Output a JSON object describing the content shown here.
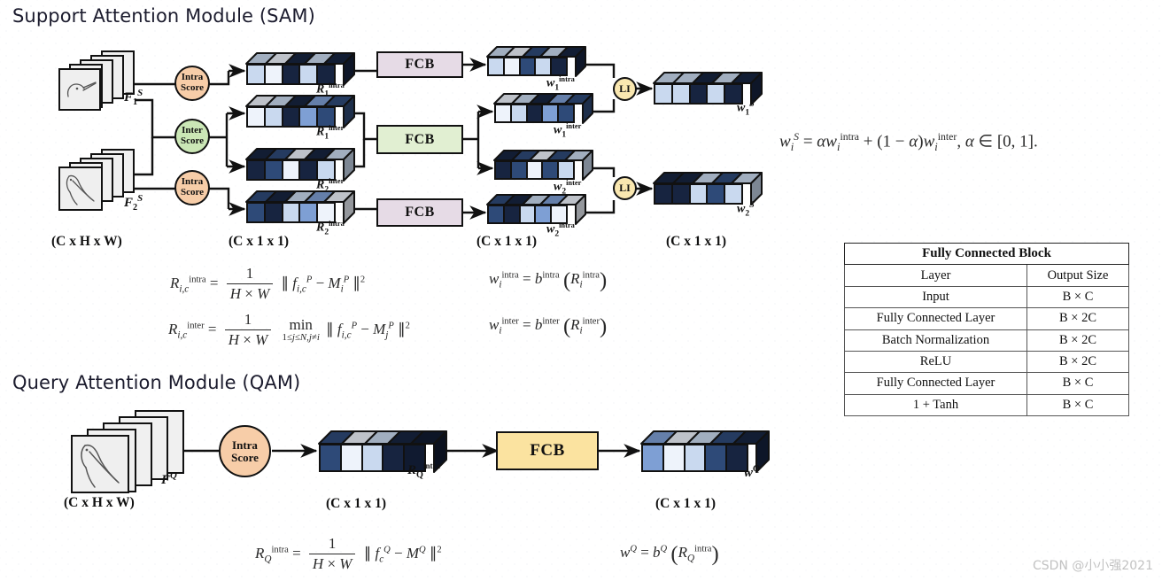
{
  "page": {
    "watermark": "CSDN @小小强2021"
  },
  "modules": {
    "sam": {
      "title": "Support Attention Module (SAM)",
      "inputs": [
        {
          "label_base": "F",
          "label_sub": "1",
          "label_sup": "S",
          "dim": "(C x H x W)",
          "icon": "bird-feature-map-stack"
        },
        {
          "label_base": "F",
          "label_sub": "2",
          "label_sup": "S",
          "icon": "bird-feature-map-stack"
        }
      ],
      "score_nodes": [
        {
          "line1": "Intra",
          "line2": "Score",
          "color": "#f7cda8"
        },
        {
          "line1": "Inter",
          "line2": "Score",
          "color": "#cbe7b6"
        },
        {
          "line1": "Intra",
          "line2": "Score",
          "color": "#f7cda8"
        }
      ],
      "r_bars": [
        {
          "name": "R",
          "sub": "1",
          "sup": "intra",
          "shades": [
            2,
            1,
            5,
            2,
            5
          ]
        },
        {
          "name": "R",
          "sub": "1",
          "sup": "inter",
          "shades": [
            1,
            2,
            5,
            3,
            4
          ]
        },
        {
          "name": "R",
          "sub": "2",
          "sup": "inter",
          "shades": [
            5,
            4,
            1,
            5,
            2
          ]
        },
        {
          "name": "R",
          "sub": "2",
          "sup": "intra",
          "shades": [
            4,
            5,
            2,
            3,
            1
          ]
        }
      ],
      "r_dim": "(C x 1 x 1)",
      "fcb_blocks": [
        {
          "label": "FCB",
          "color": "#e6dbe6"
        },
        {
          "label": "FCB",
          "color": "#e1efd2"
        },
        {
          "label": "FCB",
          "color": "#e6dbe6"
        }
      ],
      "w_bars": [
        {
          "name": "w",
          "sub": "1",
          "sup": "intra",
          "shades": [
            2,
            1,
            4,
            2,
            5
          ]
        },
        {
          "name": "w",
          "sub": "1",
          "sup": "inter",
          "shades": [
            1,
            2,
            5,
            3,
            4
          ]
        },
        {
          "name": "w",
          "sub": "2",
          "sup": "inter",
          "shades": [
            5,
            4,
            1,
            4,
            2
          ]
        },
        {
          "name": "w",
          "sub": "2",
          "sup": "intra",
          "shades": [
            4,
            5,
            2,
            3,
            1
          ]
        }
      ],
      "w_dim": "(C x 1 x 1)",
      "li_nodes": [
        {
          "label": "LI",
          "color": "#f9e7b0"
        },
        {
          "label": "LI",
          "color": "#f9e7b0"
        }
      ],
      "out_bars": [
        {
          "name": "w",
          "sub": "1",
          "sup": "S",
          "shades": [
            2,
            2,
            5,
            2,
            5
          ]
        },
        {
          "name": "w",
          "sub": "2",
          "sup": "S",
          "shades": [
            5,
            5,
            2,
            4,
            2
          ]
        }
      ],
      "out_dim": "(C x 1 x 1)"
    },
    "qam": {
      "title": "Query Attention Module (QAM)",
      "input": {
        "label_base": "F",
        "label_sup": "Q",
        "dim": "(C x H x W)",
        "icon": "bird-feature-map-stack"
      },
      "score_node": {
        "line1": "Intra",
        "line2": "Score",
        "color": "#f7cda8"
      },
      "r_bar": {
        "name": "R",
        "sub": "Q",
        "sup": "intra",
        "shades": [
          4,
          1,
          2,
          5,
          6
        ],
        "dim": "(C x 1 x 1)"
      },
      "fcb": {
        "label": "FCB",
        "color": "#fbe3a0"
      },
      "w_bar": {
        "name": "w",
        "sup": "Q",
        "shades": [
          3,
          1,
          2,
          4,
          5
        ],
        "dim": "(C x 1 x 1)"
      }
    }
  },
  "equations": {
    "fusion": "w_i^S = α w_i^intra + (1 − α) w_i^inter ,  α ∈ [0, 1].",
    "r_intra": "R_{i,c}^intra = 1/(H × W) ‖ f_{i,c}^P − M_i^P ‖²",
    "r_inter": "R_{i,c}^inter = 1/(H × W) min_{1≤j≤N, j≠i} ‖ f_{i,c}^P − M_j^P ‖²",
    "w_intra": "w_i^intra = b^intra ( R_i^intra )",
    "w_inter": "w_i^inter = b^inter ( R_i^inter )",
    "rq_intra": "R_Q^intra = 1/(H × W) ‖ f_c^Q − M^Q ‖²",
    "wq": "w^Q = b^Q ( R_Q^intra )"
  },
  "fcb_table": {
    "title": "Fully Connected Block",
    "columns": [
      "Layer",
      "Output Size"
    ],
    "rows": [
      [
        "Input",
        "B × C"
      ],
      [
        "Fully Connected Layer",
        "B × 2C"
      ],
      [
        "Batch Normalization",
        "B × 2C"
      ],
      [
        "ReLU",
        "B × 2C"
      ],
      [
        "Fully Connected Layer",
        "B × C"
      ],
      [
        "1 + Tanh",
        "B × C"
      ]
    ]
  },
  "palette": {
    "shade1": "#eef3fb",
    "shade2": "#c9d9ef",
    "shade3": "#7e9fd4",
    "shade4": "#2e4a78",
    "shade5": "#172440",
    "shade6": "#101a30",
    "outline": "#111111"
  }
}
